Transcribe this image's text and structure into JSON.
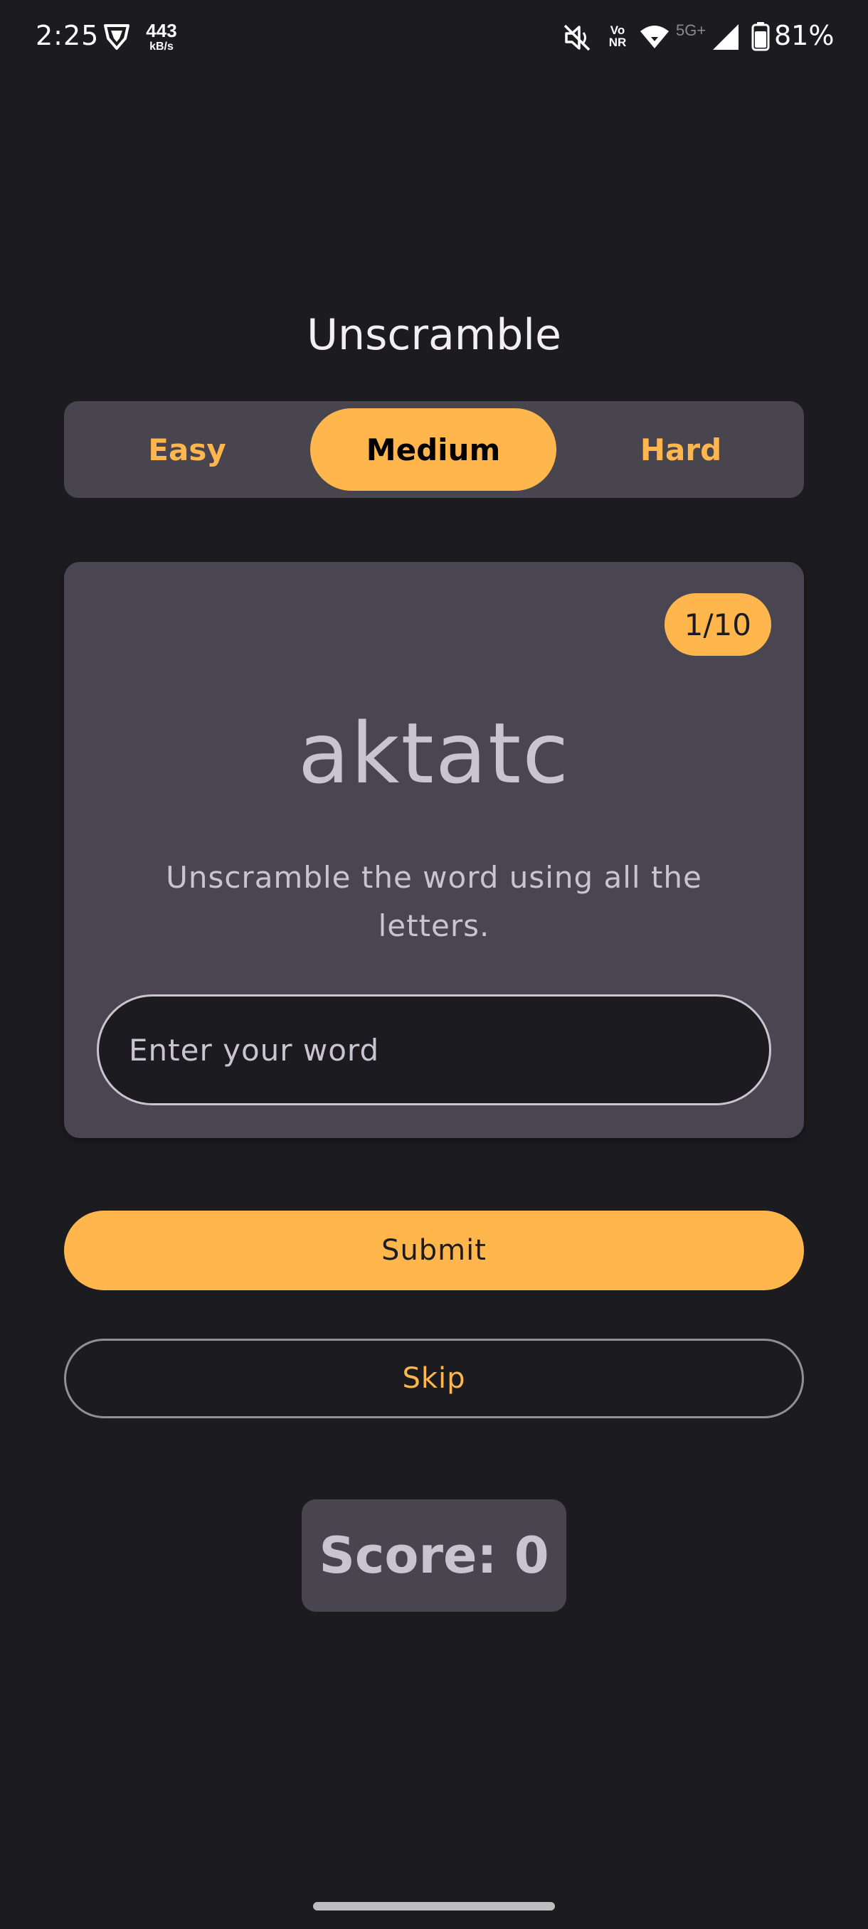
{
  "status_bar": {
    "time": "2:25",
    "net_speed_value": "443",
    "net_speed_unit": "kB/s",
    "volte_top": "Vo",
    "volte_bottom": "NR",
    "network_type": "5G+",
    "battery_percent": "81%",
    "icons": [
      "vpn-shield-icon",
      "mute-icon",
      "wifi-icon",
      "signal-icon",
      "battery-icon"
    ]
  },
  "app": {
    "title": "Unscramble"
  },
  "difficulty": {
    "options": [
      {
        "label": "Easy",
        "selected": false
      },
      {
        "label": "Medium",
        "selected": true
      },
      {
        "label": "Hard",
        "selected": false
      }
    ]
  },
  "card": {
    "counter": "1/10",
    "scrambled_word": "aktatc",
    "instructions": "Unscramble the word using all the letters.",
    "input_value": "",
    "input_placeholder": "Enter your word"
  },
  "actions": {
    "submit_label": "Submit",
    "skip_label": "Skip"
  },
  "score": {
    "text": "Score: 0"
  },
  "colors": {
    "background": "#1c1b1f",
    "accent": "#ffb74d",
    "surface": "#4a4651",
    "on_surface": "#cac4d0"
  }
}
